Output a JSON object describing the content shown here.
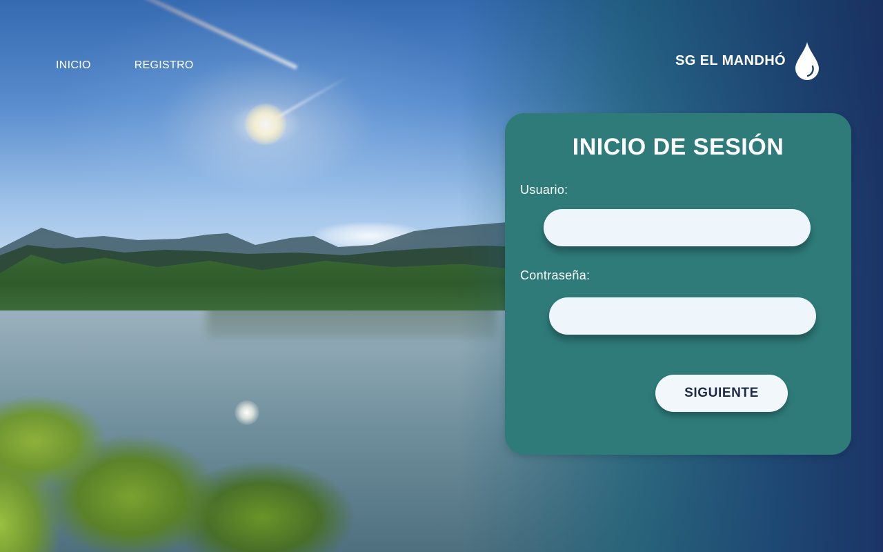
{
  "nav": {
    "items": [
      {
        "label": "INICIO"
      },
      {
        "label": "REGISTRO"
      }
    ]
  },
  "brand": {
    "name": "SG EL MANDHÓ",
    "icon": "water-drop-icon"
  },
  "login": {
    "title": "INICIO DE SESIÓN",
    "username_label": "Usuario:",
    "username_value": "",
    "password_label": "Contraseña:",
    "password_value": "",
    "submit_label": "SIGUIENTE"
  },
  "colors": {
    "card_background": "#2e7b7a",
    "input_background": "#eef5fb",
    "button_text": "#1d2a4a",
    "right_gradient_end": "#1b3467"
  }
}
